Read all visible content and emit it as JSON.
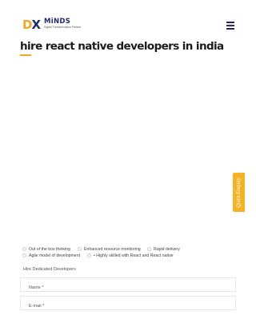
{
  "header": {
    "logo": {
      "dx_d": "D",
      "dx_x": "X",
      "minds": "MiNDS",
      "tagline": "Digital Transformation Partner"
    },
    "menu_icon": "hamburger-icon"
  },
  "title": "hire react native developers in india",
  "quick_enquiry": {
    "label": "Quick Enquiry"
  },
  "features": [
    "Out of the box thinking",
    "Enhanced resource monitoring",
    "Rapid delivery",
    "Agile model of development",
    "• Highly skilled with React and React native"
  ],
  "form": {
    "title": "Hire Dedicated Developers",
    "name": {
      "placeholder": "Name *",
      "value": ""
    },
    "email": {
      "placeholder": "E-mail *",
      "value": ""
    }
  },
  "colors": {
    "accent": "#f5a623",
    "brand": "#1f2a6b"
  }
}
